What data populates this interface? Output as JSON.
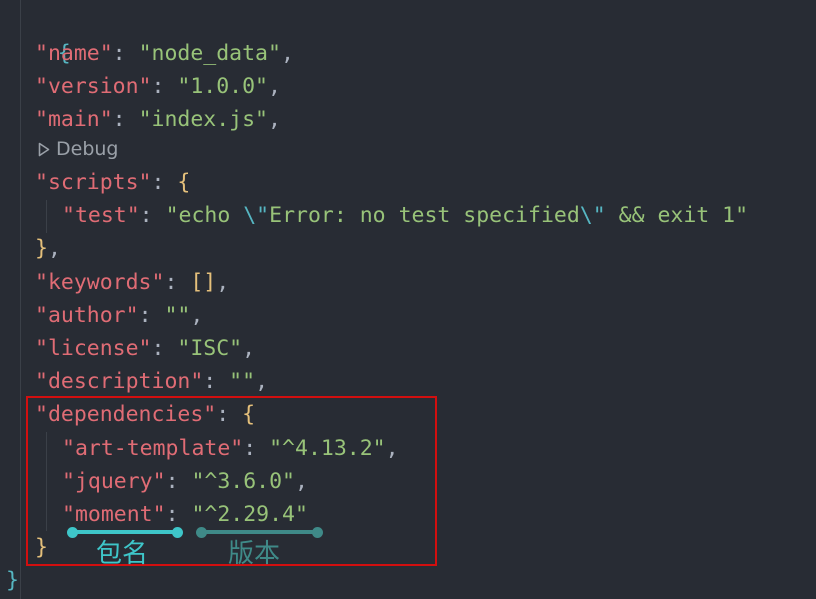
{
  "tokens": {
    "open_brace": "{",
    "close_brace": "}",
    "colon": ": ",
    "comma": ",",
    "quote": "\"",
    "empty_array": "[]",
    "empty_string": "\"\""
  },
  "codelens": {
    "icon": "play-triangle-icon",
    "label": "Debug"
  },
  "package_json": {
    "name": {
      "key": "\"name\"",
      "value": "\"node_data\""
    },
    "version": {
      "key": "\"version\"",
      "value": "\"1.0.0\""
    },
    "main": {
      "key": "\"main\"",
      "value": "\"index.js\""
    },
    "scripts": {
      "key": "\"scripts\"",
      "test": {
        "key": "\"test\"",
        "value_start": "\"echo ",
        "escape_1": "\\\"",
        "value_middle": "Error: no test specified",
        "escape_2": "\\\"",
        "value_end": " && exit 1\""
      }
    },
    "keywords": {
      "key": "\"keywords\""
    },
    "author": {
      "key": "\"author\""
    },
    "license": {
      "key": "\"license\"",
      "value": "\"ISC\""
    },
    "description": {
      "key": "\"description\""
    },
    "dependencies": {
      "key": "\"dependencies\"",
      "items": [
        {
          "key": "\"art-template\"",
          "value": "\"^4.13.2\""
        },
        {
          "key": "\"jquery\"",
          "value": "\"^3.6.0\""
        },
        {
          "key": "\"moment\"",
          "value": "\"^2.29.4\""
        }
      ]
    }
  },
  "annotations": {
    "package_name_label": "包名",
    "version_label": "版本",
    "highlight_color": "#d20f0f",
    "name_marker_color": "#3ec6c9",
    "version_marker_color": "#3f8a88"
  },
  "colors": {
    "background": "#282c34",
    "key": "#e06c75",
    "string": "#98c379",
    "escape": "#56b6c2",
    "outer_brace": "#56b6c2",
    "inner_brace": "#e5c07b"
  }
}
